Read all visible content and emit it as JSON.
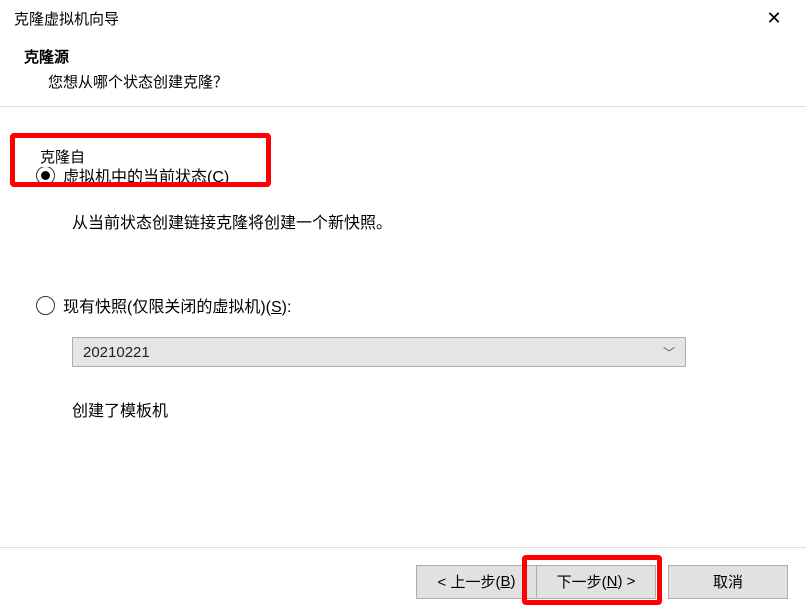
{
  "window": {
    "title": "克隆虚拟机向导"
  },
  "header": {
    "title": "克隆源",
    "subtitle": "您想从哪个状态创建克隆？"
  },
  "fieldset": {
    "legend": "克隆自"
  },
  "option_current": {
    "label_prefix": "虚拟机中的当前状态(",
    "label_key": "C",
    "label_suffix": ")",
    "description": "从当前状态创建链接克隆将创建一个新快照。",
    "selected": true
  },
  "option_snapshot": {
    "label_prefix": "现有快照(仅限关闭的虚拟机)(",
    "label_key": "S",
    "label_suffix": "):",
    "selected": false,
    "dropdown_value": "20210221",
    "description": "创建了模板机"
  },
  "buttons": {
    "back_prefix": "< 上一步(",
    "back_key": "B",
    "back_suffix": ")",
    "next_prefix": "下一步(",
    "next_key": "N",
    "next_suffix": ") >",
    "cancel": "取消"
  }
}
